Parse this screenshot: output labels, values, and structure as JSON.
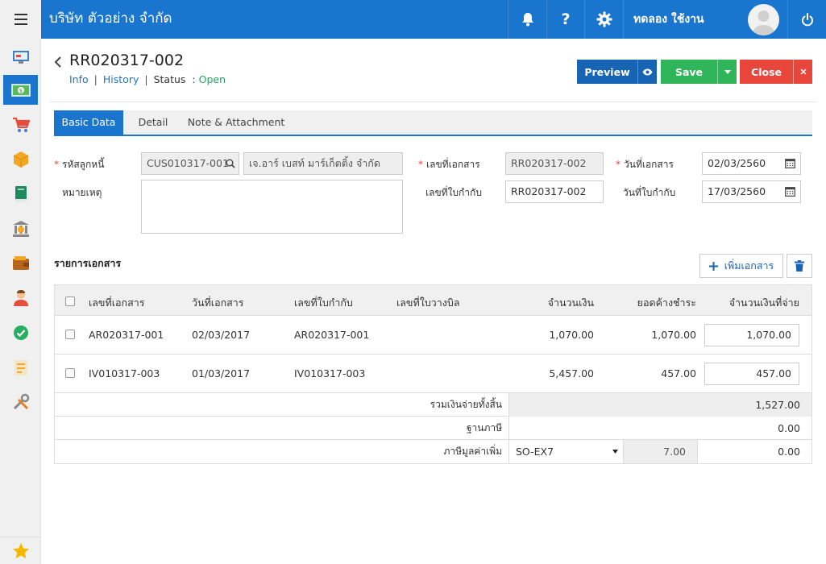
{
  "app": {
    "company_name": "บริษัท ตัวอย่าง จำกัด",
    "username": "ทดลอง ใช้งาน"
  },
  "header": {
    "doc_title": "RR020317-002",
    "subnav": {
      "info": "Info",
      "history": "History",
      "status_label": "Status",
      "status_sep": ":",
      "status_value": "Open"
    },
    "buttons": {
      "preview": "Preview",
      "save": "Save",
      "close": "Close"
    }
  },
  "tabs": [
    {
      "label": "Basic Data",
      "active": true
    },
    {
      "label": "Detail",
      "active": false
    },
    {
      "label": "Note & Attachment",
      "active": false
    }
  ],
  "form": {
    "debtor_code_label": "รหัสลูกหนี้",
    "debtor_code": "CUS010317-001",
    "debtor_name": "เจ.อาร์ เบสท์ มาร์เก็ตติ้ง จำกัด",
    "remark_label": "หมายเหตุ",
    "remark": "",
    "doc_no_label": "เลขที่เอกสาร",
    "doc_no": "RR020317-002",
    "tax_no_label": "เลขที่ใบกำกับ",
    "tax_no": "RR020317-002",
    "doc_date_label": "วันที่เอกสาร",
    "doc_date": "02/03/2560",
    "tax_date_label": "วันที่ใบกำกับ",
    "tax_date": "17/03/2560"
  },
  "documents": {
    "title": "รายการเอกสาร",
    "add_button": "เพิ่มเอกสาร",
    "columns": [
      "เลขที่เอกสาร",
      "วันที่เอกสาร",
      "เลขที่ใบกำกับ",
      "เลขที่ใบวางบิล",
      "จำนวนเงิน",
      "ยอดค้างชำระ",
      "จำนวนเงินที่จ่าย"
    ],
    "rows": [
      {
        "doc_no": "AR020317-001",
        "doc_date": "02/03/2017",
        "tax_no": "AR020317-001",
        "bill_no": "",
        "amount": "1,070.00",
        "outstanding": "1,070.00",
        "paid": "1,070.00"
      },
      {
        "doc_no": "IV010317-003",
        "doc_date": "01/03/2017",
        "tax_no": "IV010317-003",
        "bill_no": "",
        "amount": "5,457.00",
        "outstanding": "457.00",
        "paid": "457.00"
      }
    ],
    "summary": {
      "total_label": "รวมเงินจ่ายทั้งสิ้น",
      "total_value": "1,527.00",
      "tax_base_label": "ฐานภาษี",
      "tax_base_value": "0.00",
      "vat_label": "ภาษีมูลค่าเพิ่ม",
      "vat_code": "SO-EX7",
      "vat_rate": "7.00",
      "vat_value": "0.00"
    }
  },
  "colors": {
    "primary": "#1a75cf",
    "save": "#30b55a",
    "close": "#e8463a",
    "status_open": "#27a062"
  },
  "icons": {
    "topbar": [
      "menu-icon",
      "bell-icon",
      "question-icon",
      "gear-icon",
      "power-icon"
    ],
    "sidebar": [
      "dashboard-icon",
      "money-icon",
      "cart-icon",
      "box-icon",
      "book-icon",
      "bank-icon",
      "wallet-icon",
      "people-icon",
      "check-icon",
      "report-icon",
      "tools-icon",
      "star-icon"
    ]
  }
}
